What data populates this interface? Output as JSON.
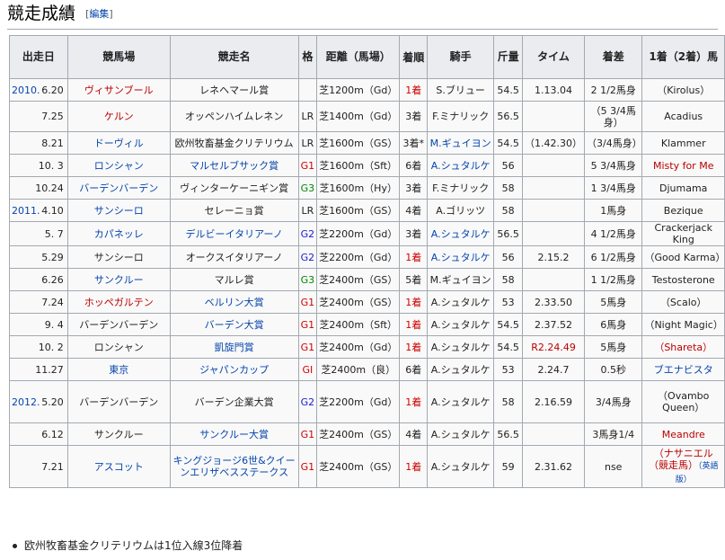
{
  "section": {
    "title": "競走成績",
    "edit_open": "[",
    "edit_label": "編集",
    "edit_close": "]"
  },
  "table": {
    "headers": [
      "出走日",
      "競馬場",
      "競走名",
      "格",
      "距離（馬場）",
      "着順",
      "騎手",
      "斤量",
      "タイム",
      "着差",
      "1着（2着）馬"
    ],
    "rows": [
      {
        "year": "2010.",
        "date": "6.20",
        "course": "ヴィサンブール",
        "course_style": "red",
        "race": "レネヘマール賞",
        "race_style": "",
        "grade": "",
        "distance": "芝1200m（Gd）",
        "place": "1着",
        "place_style": "win",
        "jockey": "S.ブリュー",
        "jockey_style": "",
        "weight": "54.5",
        "time": "1.13.04",
        "time_style": "",
        "margin": "2 1/2馬身",
        "winner": "（Kirolus）",
        "winner_style": "",
        "winner_note": ""
      },
      {
        "year": "",
        "date": "7.25",
        "course": "ケルン",
        "course_style": "red",
        "race": "オッペンハイムレネン",
        "race_style": "",
        "grade": "LR",
        "distance": "芝1400m（Gd）",
        "place": "3着",
        "place_style": "",
        "jockey": "F.ミナリック",
        "jockey_style": "",
        "weight": "56.5",
        "time": "",
        "time_style": "",
        "margin": "（5 3/4馬身）",
        "winner": "Acadius",
        "winner_style": "",
        "winner_note": ""
      },
      {
        "year": "",
        "date": "8.21",
        "course": "ドーヴィル",
        "course_style": "link",
        "race": "欧州牧畜基金クリテリウム",
        "race_style": "",
        "grade": "LR",
        "distance": "芝1600m（GS）",
        "place": "3着*",
        "place_style": "",
        "jockey": "M.ギュイヨン",
        "jockey_style": "link",
        "weight": "54.5",
        "time": "（1.42.30）",
        "time_style": "",
        "margin": "（3/4馬身）",
        "winner": "Klammer",
        "winner_style": "",
        "winner_note": ""
      },
      {
        "year": "",
        "date": "10. 3",
        "course": "ロンシャン",
        "course_style": "link",
        "race": "マルセルブサック賞",
        "race_style": "link",
        "grade": "G1",
        "distance": "芝1600m（Sft）",
        "place": "6着",
        "place_style": "",
        "jockey": "A.シュタルケ",
        "jockey_style": "link",
        "weight": "56",
        "time": "",
        "time_style": "",
        "margin": "5 3/4馬身",
        "winner": "Misty for Me",
        "winner_style": "red",
        "winner_note": ""
      },
      {
        "year": "",
        "date": "10.24",
        "course": "バーデンバーデン",
        "course_style": "link",
        "race": "ヴィンターケーニギン賞",
        "race_style": "",
        "grade": "G3",
        "distance": "芝1600m（Hy）",
        "place": "3着",
        "place_style": "",
        "jockey": "F.ミナリック",
        "jockey_style": "",
        "weight": "58",
        "time": "",
        "time_style": "",
        "margin": "1 3/4馬身",
        "winner": "Djumama",
        "winner_style": "",
        "winner_note": ""
      },
      {
        "year": "2011.",
        "date": "4.10",
        "course": "サンシーロ",
        "course_style": "link",
        "race": "セレーニョ賞",
        "race_style": "",
        "grade": "LR",
        "distance": "芝1600m（GS）",
        "place": "4着",
        "place_style": "",
        "jockey": "A.ゴリッツ",
        "jockey_style": "",
        "weight": "58",
        "time": "",
        "time_style": "",
        "margin": "1馬身",
        "winner": "Bezique",
        "winner_style": "",
        "winner_note": ""
      },
      {
        "year": "",
        "date": "5. 7",
        "course": "カパネッレ",
        "course_style": "link",
        "race": "デルビーイタリアーノ",
        "race_style": "link",
        "grade": "G2",
        "distance": "芝2200m（Gd）",
        "place": "3着",
        "place_style": "",
        "jockey": "A.シュタルケ",
        "jockey_style": "link",
        "weight": "56.5",
        "time": "",
        "time_style": "",
        "margin": "4 1/2馬身",
        "winner": "Crackerjack King",
        "winner_style": "",
        "winner_note": ""
      },
      {
        "year": "",
        "date": "5.29",
        "course": "サンシーロ",
        "course_style": "",
        "race": "オークスイタリアーノ",
        "race_style": "",
        "grade": "G2",
        "distance": "芝2200m（Gd）",
        "place": "1着",
        "place_style": "win",
        "jockey": "A.シュタルケ",
        "jockey_style": "link",
        "weight": "56",
        "time": "2.15.2",
        "time_style": "",
        "margin": "6 1/2馬身",
        "winner": "（Good Karma）",
        "winner_style": "",
        "winner_note": ""
      },
      {
        "year": "",
        "date": "6.26",
        "course": "サンクルー",
        "course_style": "link",
        "race": "マルレ賞",
        "race_style": "",
        "grade": "G3",
        "distance": "芝2400m（GS）",
        "place": "5着",
        "place_style": "",
        "jockey": "M.ギュイヨン",
        "jockey_style": "",
        "weight": "58",
        "time": "",
        "time_style": "",
        "margin": "1 1/2馬身",
        "winner": "Testosterone",
        "winner_style": "",
        "winner_note": ""
      },
      {
        "year": "",
        "date": "7.24",
        "course": "ホッペガルテン",
        "course_style": "red",
        "race": "ベルリン大賞",
        "race_style": "link",
        "grade": "G1",
        "distance": "芝2400m（GS）",
        "place": "1着",
        "place_style": "win",
        "jockey": "A.シュタルケ",
        "jockey_style": "",
        "weight": "53",
        "time": "2.33.50",
        "time_style": "",
        "margin": "5馬身",
        "winner": "（Scalo）",
        "winner_style": "",
        "winner_note": ""
      },
      {
        "year": "",
        "date": "9. 4",
        "course": "バーデンバーデン",
        "course_style": "",
        "race": "バーデン大賞",
        "race_style": "link",
        "grade": "G1",
        "distance": "芝2400m（Sft）",
        "place": "1着",
        "place_style": "win",
        "jockey": "A.シュタルケ",
        "jockey_style": "",
        "weight": "54.5",
        "time": "2.37.52",
        "time_style": "",
        "margin": "6馬身",
        "winner": "（Night Magic）",
        "winner_style": "",
        "winner_note": ""
      },
      {
        "year": "",
        "date": "10. 2",
        "course": "ロンシャン",
        "course_style": "",
        "race": "凱旋門賞",
        "race_style": "link",
        "grade": "G1",
        "distance": "芝2400m（Gd）",
        "place": "1着",
        "place_style": "win",
        "jockey": "A.シュタルケ",
        "jockey_style": "",
        "weight": "54.5",
        "time": "R2.24.49",
        "time_style": "red",
        "margin": "5馬身",
        "winner": "（Shareta）",
        "winner_style": "red",
        "winner_note": ""
      },
      {
        "year": "",
        "date": "11.27",
        "course": "東京",
        "course_style": "link",
        "race": "ジャパンカップ",
        "race_style": "link",
        "grade": "GI",
        "distance": "芝2400m（良）",
        "place": "6着",
        "place_style": "",
        "jockey": "A.シュタルケ",
        "jockey_style": "",
        "weight": "53",
        "time": "2.24.7",
        "time_style": "",
        "margin": "0.5秒",
        "winner": "ブエナビスタ",
        "winner_style": "link",
        "winner_note": ""
      },
      {
        "year": "2012.",
        "date": "5.20",
        "course": "バーデンバーデン",
        "course_style": "",
        "race": "バーデン企業大賞",
        "race_style": "",
        "grade": "G2",
        "distance": "芝2200m（Gd）",
        "place": "1着",
        "place_style": "win",
        "jockey": "A.シュタルケ",
        "jockey_style": "",
        "weight": "58",
        "time": "2.16.59",
        "time_style": "",
        "margin": "3/4馬身",
        "winner": "（Ovambo Queen）",
        "winner_style": "",
        "winner_note": ""
      },
      {
        "year": "",
        "date": "6.12",
        "course": "サンクルー",
        "course_style": "",
        "race": "サンクルー大賞",
        "race_style": "link",
        "grade": "G1",
        "distance": "芝2400m（GS）",
        "place": "4着",
        "place_style": "",
        "jockey": "A.シュタルケ",
        "jockey_style": "",
        "weight": "56.5",
        "time": "",
        "time_style": "",
        "margin": "3馬身1/4",
        "winner": "Meandre",
        "winner_style": "red",
        "winner_note": ""
      },
      {
        "year": "",
        "date": "7.21",
        "course": "アスコット",
        "course_style": "link",
        "race": "キングジョージ6世&クイーンエリザベスステークス",
        "race_style": "link",
        "grade": "G1",
        "distance": "芝2400m（GS）",
        "place": "1着",
        "place_style": "win",
        "jockey": "A.シュタルケ",
        "jockey_style": "",
        "weight": "59",
        "time": "2.31.62",
        "time_style": "",
        "margin": "nse",
        "winner": "（ナサニエル（競走馬）",
        "winner_style": "red",
        "winner_note": "（英語版）"
      }
    ]
  },
  "notes": [
    "欧州牧畜基金クリテリウムは1位入線3位降着"
  ],
  "colors": {
    "link": "#0645ad",
    "redlink": "#ba0000",
    "win": "#d00000",
    "g1": "#d00000",
    "g2": "#1a1ad0",
    "g3": "#008800",
    "header_bg": "#eaecf0",
    "border": "#a2a9b1"
  }
}
